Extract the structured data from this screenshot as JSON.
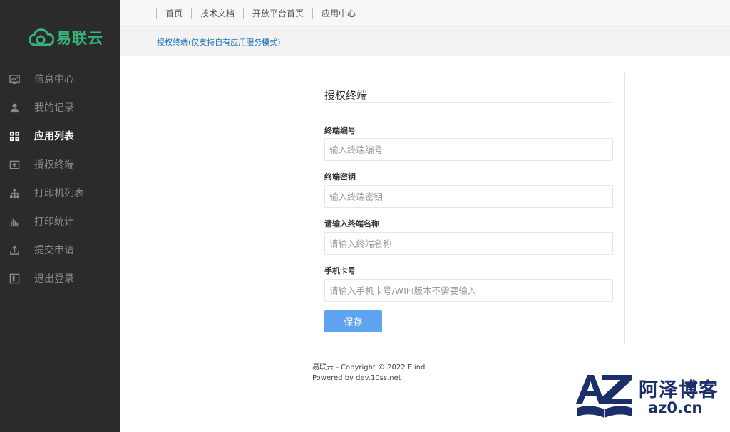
{
  "brand": {
    "name": "易联云",
    "color": "#34b37a"
  },
  "sidebar": {
    "items": [
      {
        "label": "信息中心",
        "icon": "dashboard-icon",
        "active": false
      },
      {
        "label": "我的记录",
        "icon": "user-icon",
        "active": false
      },
      {
        "label": "应用列表",
        "icon": "grid-icon",
        "active": true
      },
      {
        "label": "授权终端",
        "icon": "plus-box-icon",
        "active": false
      },
      {
        "label": "打印机列表",
        "icon": "sitemap-icon",
        "active": false
      },
      {
        "label": "打印统计",
        "icon": "bar-chart-icon",
        "active": false
      },
      {
        "label": "提交申请",
        "icon": "upload-icon",
        "active": false
      },
      {
        "label": "退出登录",
        "icon": "logout-icon",
        "active": false
      }
    ]
  },
  "topnav": {
    "links": [
      "首页",
      "技术文档",
      "开放平台首页",
      "应用中心"
    ]
  },
  "breadcrumb": "授权终端(仅支持自有应用服务模式)",
  "form": {
    "title": "授权终端",
    "fields": [
      {
        "label": "终端编号",
        "placeholder": "输入终端编号",
        "value": ""
      },
      {
        "label": "终端密钥",
        "placeholder": "输入终端密钥",
        "value": ""
      },
      {
        "label": "请输入终端名称",
        "placeholder": "请输入终端名称",
        "value": ""
      },
      {
        "label": "手机卡号",
        "placeholder": "请输入手机卡号/WIFI版本不需要输入",
        "value": ""
      }
    ],
    "save_label": "保存"
  },
  "footer": {
    "copyright": "易联云 - Copyright © 2022 Elind",
    "powered": "Powered by dev.10ss.net"
  },
  "watermark": {
    "title": "阿泽博客",
    "url": "az0.cn",
    "logo": "AZ"
  },
  "colors": {
    "sidebar_bg": "#2b2b2b",
    "accent": "#5fa4ef",
    "link": "#1e73be"
  }
}
